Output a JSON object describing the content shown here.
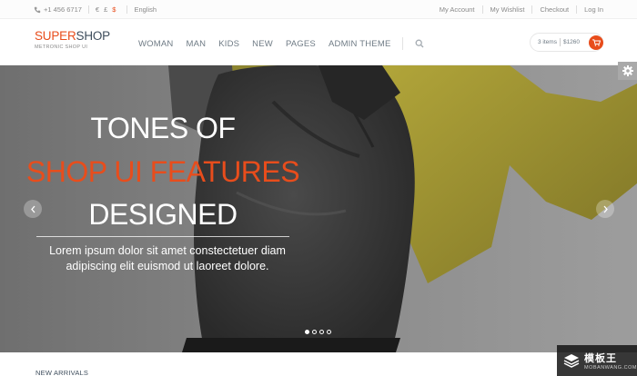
{
  "topbar": {
    "phone": "+1 456 6717",
    "currencies": [
      "€",
      "£",
      "$"
    ],
    "active_currency": "$",
    "language": "English",
    "links": [
      "My Account",
      "My Wishlist",
      "Checkout",
      "Log In"
    ]
  },
  "header": {
    "logo_part1": "SUPER",
    "logo_part2": "SHOP",
    "logo_tagline": "METRONIC SHOP UI",
    "nav": [
      "WOMAN",
      "MAN",
      "KIDS",
      "NEW",
      "PAGES",
      "ADMIN THEME"
    ],
    "cart_items": "3 items",
    "cart_total": "$1260"
  },
  "hero": {
    "line1": "TONES OF",
    "line2": "SHOP UI FEATURES",
    "line3": "DESIGNED",
    "subtitle_line1": "Lorem ipsum dolor sit amet constectetuer diam",
    "subtitle_line2": "adipiscing elit euismod ut laoreet dolore.",
    "slides": 4,
    "active_slide": 1
  },
  "section": {
    "new_arrivals": "NEW ARRIVALS"
  },
  "watermark": {
    "title": "模板王",
    "url": "MOBANWANG.COM"
  },
  "colors": {
    "accent": "#e84d1c",
    "navy": "#3e4d5c"
  }
}
